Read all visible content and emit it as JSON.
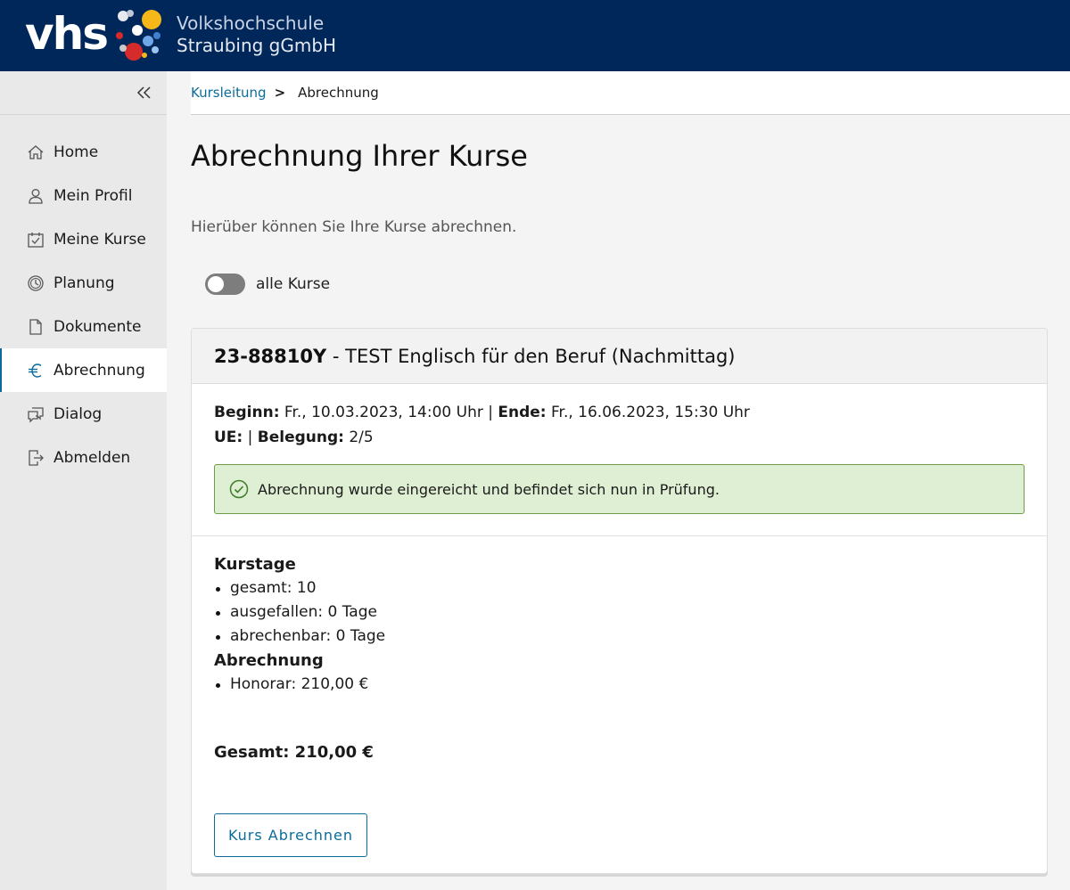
{
  "header": {
    "logo_text": "vhs",
    "org_line1": "Volkshochschule",
    "org_line2": "Straubing gGmbH",
    "bg_color": "#00275a"
  },
  "sidebar": {
    "collapse_icon": "double-chevron-left-icon",
    "items": [
      {
        "label": "Home",
        "icon": "home-icon",
        "active": false
      },
      {
        "label": "Mein Profil",
        "icon": "user-icon",
        "active": false
      },
      {
        "label": "Meine Kurse",
        "icon": "calendar-check-icon",
        "active": false
      },
      {
        "label": "Planung",
        "icon": "clock-icon",
        "active": false
      },
      {
        "label": "Dokumente",
        "icon": "document-icon",
        "active": false
      },
      {
        "label": "Abrechnung",
        "icon": "euro-icon",
        "active": true
      },
      {
        "label": "Dialog",
        "icon": "chat-icon",
        "active": false
      },
      {
        "label": "Abmelden",
        "icon": "logout-icon",
        "active": false
      }
    ]
  },
  "breadcrumb": {
    "parent": "Kursleitung",
    "separator": ">",
    "current": "Abrechnung"
  },
  "page": {
    "title": "Abrechnung Ihrer Kurse",
    "intro": "Hierüber können Sie Ihre Kurse abrechnen.",
    "toggle_label": "alle Kurse",
    "toggle_on": false
  },
  "course": {
    "number": "23-88810Y",
    "title_sep": " - ",
    "title": "TEST Englisch für den Beruf (Nachmittag)",
    "begin_label": "Beginn:",
    "begin_value": " Fr., 10.03.2023, 14:00 Uhr | ",
    "end_label": "Ende:",
    "end_value": " Fr., 16.06.2023, 15:30 Uhr",
    "ue_label": "UE:",
    "ue_value": " | ",
    "occupancy_label": "Belegung:",
    "occupancy_value": " 2/5",
    "status_message": "Abrechnung wurde eingereicht und befindet sich nun in Prüfung.",
    "status_color": "#dfefd4",
    "kurstage_heading": "Kurstage",
    "kurstage": [
      "gesamt: 10",
      "ausgefallen: 0 Tage",
      "abrechenbar: 0 Tage"
    ],
    "abrechnung_heading": "Abrechnung",
    "abrechnung": [
      "Honorar: 210,00 €"
    ],
    "total": "Gesamt: 210,00 €",
    "button_label": "Kurs Abrechnen"
  },
  "accent_color": "#0b6c9a"
}
